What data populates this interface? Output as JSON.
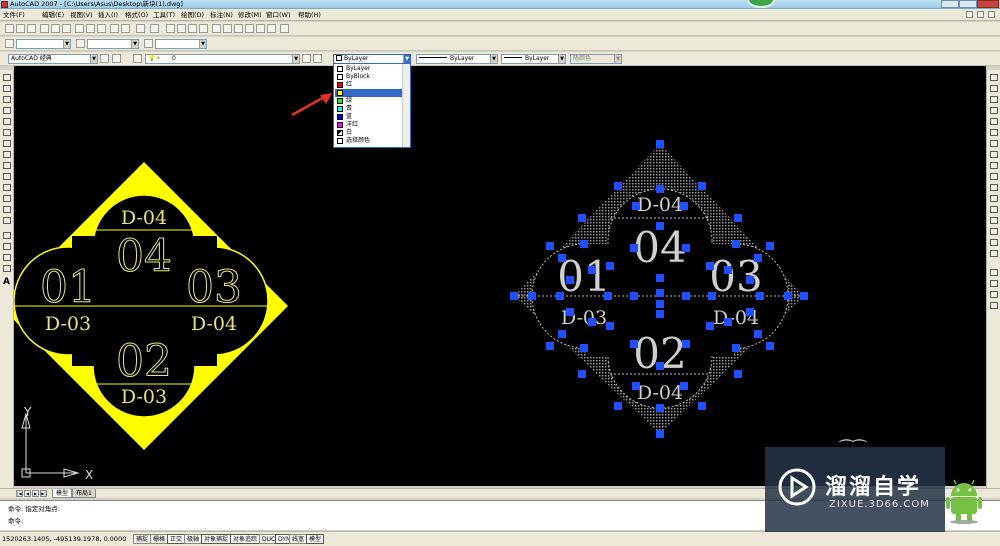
{
  "window": {
    "title": "AutoCAD 2007 - [C:\\Users\\Asus\\Desktop\\新块(1).dwg]"
  },
  "menu": {
    "items": [
      "文件(F)",
      "编辑(E)",
      "视图(V)",
      "插入(I)",
      "格式(O)",
      "工具(T)",
      "绘图(D)",
      "标注(N)",
      "修改(M)",
      "窗口(W)",
      "帮助(H)"
    ]
  },
  "workspace": {
    "name": "AutoCAD 经典",
    "layer": "0"
  },
  "properties": {
    "color_value": "ByLayer",
    "linetype_value": "ByLayer",
    "lineweight_value": "ByLayer",
    "plotstyle_value": "随颜色"
  },
  "color_dropdown": {
    "items": [
      {
        "label": "ByLayer",
        "swatch": "#ffffff"
      },
      {
        "label": "ByBlock",
        "swatch": "#ffffff"
      },
      {
        "label": "红",
        "swatch": "#ff0000"
      },
      {
        "label": "黄",
        "swatch": "#ffff00"
      },
      {
        "label": "绿",
        "swatch": "#00ff00"
      },
      {
        "label": "青",
        "swatch": "#00ffff"
      },
      {
        "label": "蓝",
        "swatch": "#0000ff"
      },
      {
        "label": "洋红",
        "swatch": "#ff00ff"
      },
      {
        "label": "白",
        "swatch": "#ffffff"
      },
      {
        "label": "选择颜色",
        "swatch": "#ffffff"
      }
    ],
    "selected_index": 3
  },
  "drawing_left": {
    "labels": {
      "top_code": "D-04",
      "top_num": "04",
      "left_num": "01",
      "left_code": "D-03",
      "right_num": "03",
      "right_code": "D-04",
      "bottom_num": "02",
      "bottom_code": "D-03"
    },
    "color": "#ffff00"
  },
  "drawing_right": {
    "labels": {
      "top_code": "D-04",
      "top_num": "04",
      "left_num": "01",
      "left_code": "D-03",
      "right_num": "03",
      "right_code": "D-04",
      "bottom_num": "02",
      "bottom_code": "D-04"
    },
    "color": "#cfcfcf",
    "grip_color": "#1f4fff"
  },
  "ucs": {
    "x_label": "X",
    "y_label": "Y"
  },
  "layout_tabs": {
    "tabs": [
      "模型",
      "布局1"
    ]
  },
  "command_line": {
    "line1": "命令: 指定对角点:",
    "line2": "命令:"
  },
  "status_bar": {
    "coords": "1520263.1405, -495139.1978, 0.0000",
    "toggles": [
      "捕捉",
      "栅格",
      "正交",
      "极轴",
      "对象捕捉",
      "对象追踪",
      "DUCS",
      "DYN",
      "线宽",
      "模型"
    ]
  },
  "watermark": {
    "title": "溜溜自学",
    "url": "ZIXUE.3D66.COM"
  }
}
